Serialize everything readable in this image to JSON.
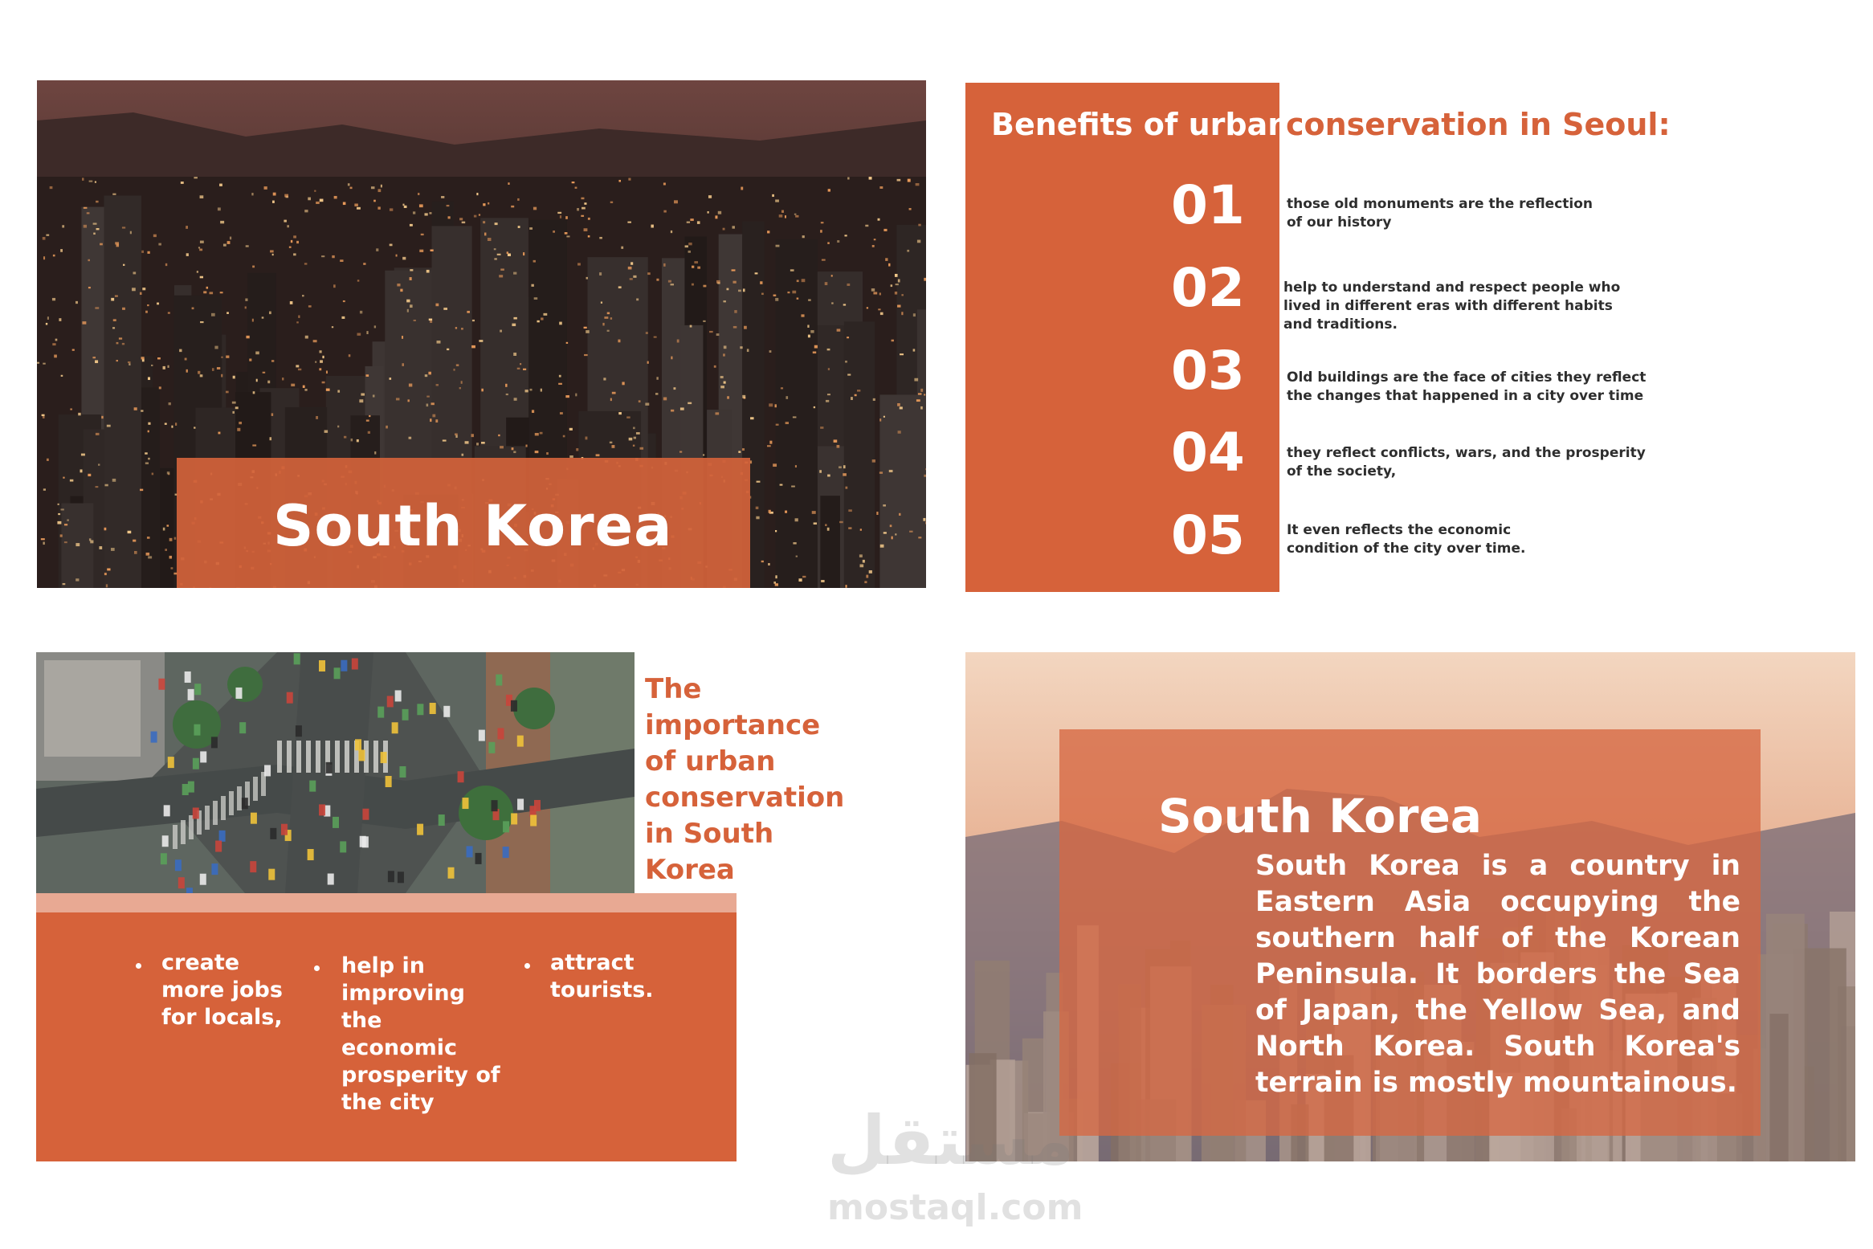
{
  "slide1": {
    "title": "South Korea"
  },
  "slide2": {
    "heading_part1": "Benefits of urban",
    "heading_part2": "conservation  in Seoul:",
    "items": [
      {
        "number": "01",
        "text": "those old monuments are the reflection of our history"
      },
      {
        "number": "02",
        "text": "help to understand and respect people who lived in different eras with different habits and traditions."
      },
      {
        "number": "03",
        "text": "Old buildings are the face of cities they reflect the changes that happened in a city over time"
      },
      {
        "number": "04",
        "text": "they reflect conflicts, wars, and the prosperity of the society,"
      },
      {
        "number": "05",
        "text": "It even reflects the economic condition of the city over time."
      }
    ]
  },
  "slide3": {
    "title": "The importance of urban conservation in South Korea",
    "bullets": [
      "create more jobs for locals,",
      "help in improving the economic prosperity of the city",
      "attract tourists."
    ]
  },
  "slide4": {
    "title": "South Korea",
    "body": "South Korea is a country in Eastern Asia occupying the southern half of the Korean Peninsula. It borders the Sea of Japan, the Yellow Sea, and North Korea. South Korea's terrain is mostly mountainous."
  },
  "watermark": {
    "arabic": "مستقل",
    "latin": "mostaql.com"
  },
  "colors": {
    "accent": "#d6623a",
    "text_dark": "#2e2e2e",
    "white": "#ffffff"
  }
}
